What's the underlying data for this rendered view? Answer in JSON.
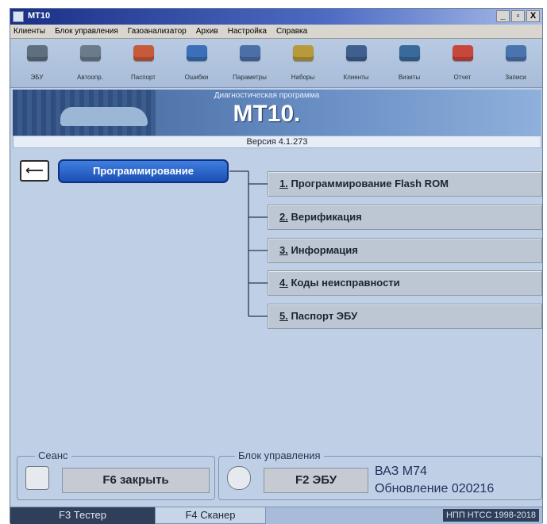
{
  "window": {
    "title": "MT10",
    "minimize": "_",
    "maximize": "▫",
    "close": "X"
  },
  "menu": [
    "Клиенты",
    "Блок управления",
    "Газоанализатор",
    "Архив",
    "Настройка",
    "Справка"
  ],
  "toolbar": [
    {
      "label": "ЭБУ",
      "icon": "ecu-icon",
      "color": "#5f6f80"
    },
    {
      "label": "Автоопр.",
      "icon": "auto-detect-icon",
      "color": "#6b7b8c"
    },
    {
      "label": "Паспорт",
      "icon": "passport-icon",
      "color": "#c85a3c"
    },
    {
      "label": "Ошибки",
      "icon": "errors-icon",
      "color": "#3b6fb8"
    },
    {
      "label": "Параметры",
      "icon": "parameters-icon",
      "color": "#4b70a8"
    },
    {
      "label": "Наборы",
      "icon": "sets-icon",
      "color": "#b79a3c"
    },
    {
      "label": "Клиенты",
      "icon": "clients-icon",
      "color": "#3f5f8f"
    },
    {
      "label": "Визиты",
      "icon": "visits-icon",
      "color": "#3a6a9a"
    },
    {
      "label": "Отчет",
      "icon": "report-icon",
      "color": "#c8463c"
    },
    {
      "label": "Записи",
      "icon": "records-icon",
      "color": "#4a74b0"
    }
  ],
  "banner": {
    "subtitle": "Диагностическая программа",
    "title": "MT10."
  },
  "version": "Версия 4.1.273",
  "programming": {
    "label": "Программирование",
    "items": [
      {
        "num": "1.",
        "text": " Программирование Flash ROM"
      },
      {
        "num": "2.",
        "text": " Верификация"
      },
      {
        "num": "3.",
        "text": " Информация"
      },
      {
        "num": "4.",
        "text": " Коды неисправности"
      },
      {
        "num": "5.",
        "text": " Паспорт ЭБУ"
      }
    ]
  },
  "session": {
    "label": "Сеанс",
    "button": "F6 закрыть"
  },
  "ecu": {
    "label": "Блок управления",
    "button": "F2 ЭБУ",
    "model": "ВАЗ М74",
    "update": "Обновление 020216"
  },
  "tabs": {
    "tester": "F3 Тестер",
    "scanner": "F4 Сканер"
  },
  "copyright": "НПП НТСС 1998-2018"
}
